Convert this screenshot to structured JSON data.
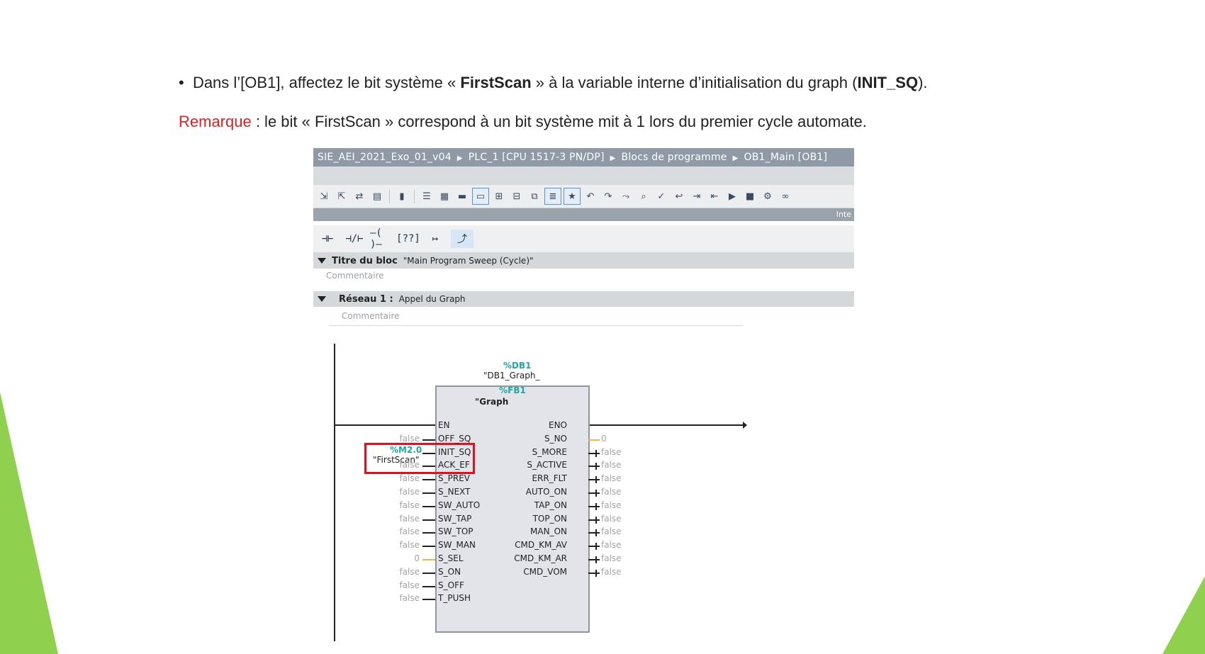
{
  "slide": {
    "bullet": {
      "prefix": "Dans l’[OB1], affectez le bit système « ",
      "bold1": "FirstScan",
      "middle": " » à la variable interne d’initialisation du graph (",
      "bold2": "INIT_SQ",
      "suffix": ")."
    },
    "remark": {
      "label": "Remarque",
      "text": " : le bit « FirstScan » correspond à un bit système mit à 1 lors du premier cycle automate."
    },
    "colors": {
      "accent_green": "#8fd14f",
      "remark_red": "#e02020",
      "highlight_box": "#e0101e",
      "operand_teal": "#20a8a0"
    }
  },
  "tia": {
    "breadcrumb": [
      "SIE_AEI_2021_Exo_01_v04",
      "PLC_1 [CPU 1517-3 PN/DP]",
      "Blocs de programme",
      "OB1_Main [OB1]"
    ],
    "scroll_label": "Inte",
    "toolbar_icons": [
      "download-icon",
      "upload-icon",
      "compare-icon",
      "monitor-icon",
      "lock-icon",
      "network-icon",
      "list-icon",
      "grid-icon",
      "comment-icon",
      "insert-icon",
      "insert-down-icon",
      "copy-down-icon",
      "list-view-icon",
      "favorite-icon",
      "undo-icon",
      "redo-icon",
      "goto-icon",
      "find-icon",
      "check-icon",
      "back-icon",
      "indent-icon",
      "outdent-icon",
      "run-icon",
      "stop-icon",
      "settings-icon",
      "glasses-icon"
    ],
    "ladder_tools": [
      "⊣⊢",
      "⊣/⊢",
      "–( )–",
      "[??]",
      "↦",
      "⤴"
    ],
    "block_title": {
      "label": "Titre du bloc",
      "value": "\"Main Program Sweep (Cycle)\"",
      "comment": "Commentaire"
    },
    "network": {
      "label": "Réseau 1 :",
      "value": "Appel du Graph",
      "comment": "Commentaire"
    },
    "fb": {
      "db_number": "%DB1",
      "db_name": "\"DB1_Graph_",
      "fb_number": "%FB1",
      "fb_name": "\"Graph",
      "operand_address": "%M2.0",
      "operand_name": "\"FirstScan\"",
      "inputs": [
        {
          "name": "EN",
          "value": ""
        },
        {
          "name": "OFF_SQ",
          "value": "false"
        },
        {
          "name": "INIT_SQ",
          "value": ""
        },
        {
          "name": "ACK_EF",
          "value": "false"
        },
        {
          "name": "S_PREV",
          "value": "false"
        },
        {
          "name": "S_NEXT",
          "value": "false"
        },
        {
          "name": "SW_AUTO",
          "value": "false"
        },
        {
          "name": "SW_TAP",
          "value": "false"
        },
        {
          "name": "SW_TOP",
          "value": "false"
        },
        {
          "name": "SW_MAN",
          "value": "false"
        },
        {
          "name": "S_SEL",
          "value": "0"
        },
        {
          "name": "S_ON",
          "value": "false"
        },
        {
          "name": "S_OFF",
          "value": "false"
        },
        {
          "name": "T_PUSH",
          "value": "false"
        }
      ],
      "outputs": [
        {
          "name": "ENO",
          "value": ""
        },
        {
          "name": "S_NO",
          "value": "0"
        },
        {
          "name": "S_MORE",
          "value": "false"
        },
        {
          "name": "S_ACTIVE",
          "value": "false"
        },
        {
          "name": "ERR_FLT",
          "value": "false"
        },
        {
          "name": "AUTO_ON",
          "value": "false"
        },
        {
          "name": "TAP_ON",
          "value": "false"
        },
        {
          "name": "TOP_ON",
          "value": "false"
        },
        {
          "name": "MAN_ON",
          "value": "false"
        },
        {
          "name": "CMD_KM_AV",
          "value": "false"
        },
        {
          "name": "CMD_KM_AR",
          "value": "false"
        },
        {
          "name": "CMD_VOM",
          "value": "false"
        }
      ]
    }
  }
}
